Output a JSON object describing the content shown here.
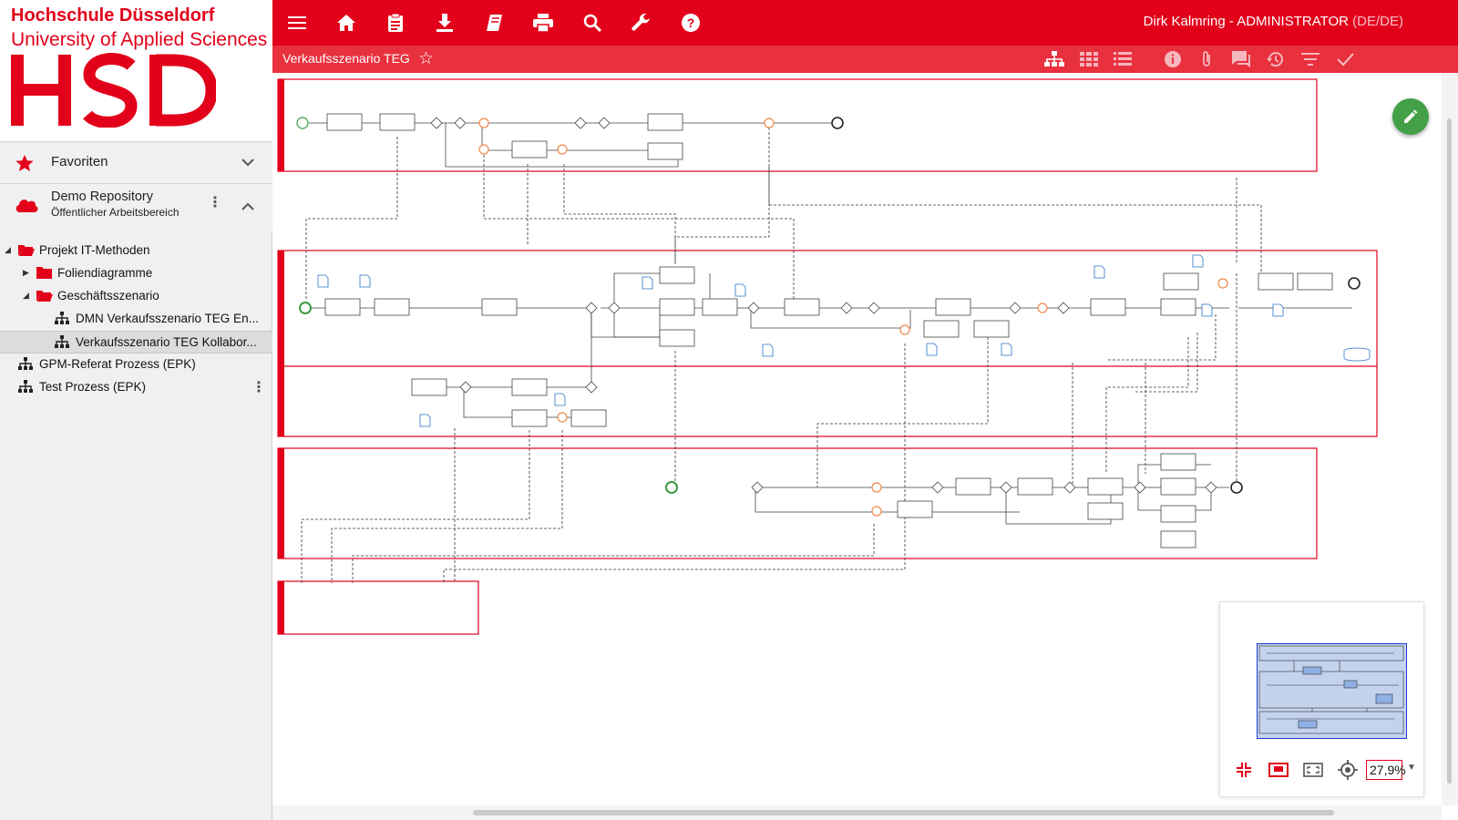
{
  "logo": {
    "line1": "Hochschule Düsseldorf",
    "line2": "University of Applied Sciences",
    "mark": "HSD"
  },
  "sidebar": {
    "favorites_label": "Favoriten",
    "repo_title": "Demo Repository",
    "repo_subtitle": "Öffentlicher Arbeitsbereich",
    "tree": [
      {
        "label": "Projekt IT-Methoden"
      },
      {
        "label": "Foliendiagramme"
      },
      {
        "label": "Geschäftsszenario"
      },
      {
        "label": "DMN Verkaufsszenario TEG En..."
      },
      {
        "label": "Verkaufsszenario TEG Kollabor..."
      },
      {
        "label": "GPM-Referat Prozess (EPK)"
      },
      {
        "label": "Test Prozess (EPK)"
      }
    ]
  },
  "toolbar": {
    "icons": [
      "menu-icon",
      "home-icon",
      "clipboard-icon",
      "download-icon",
      "book-icon",
      "print-icon",
      "search-icon",
      "wrench-icon",
      "help-icon"
    ],
    "user": "Dirk Kalmring - ADMINISTRATOR",
    "lang": "(DE/DE)"
  },
  "subbar": {
    "title": "Verkaufsszenario TEG",
    "icons": [
      "hierarchy-icon",
      "grid-icon",
      "list-icon",
      "info-icon",
      "attachment-icon",
      "comment-icon",
      "history-icon",
      "filter-icon",
      "check-icon"
    ]
  },
  "minimap": {
    "zoom": "27,9%"
  },
  "colors": {
    "brand": "#e2001a",
    "subbar": "#e8303e",
    "fab": "#43a047",
    "event_orange": "#f0884a",
    "event_green": "#3a9a45"
  }
}
